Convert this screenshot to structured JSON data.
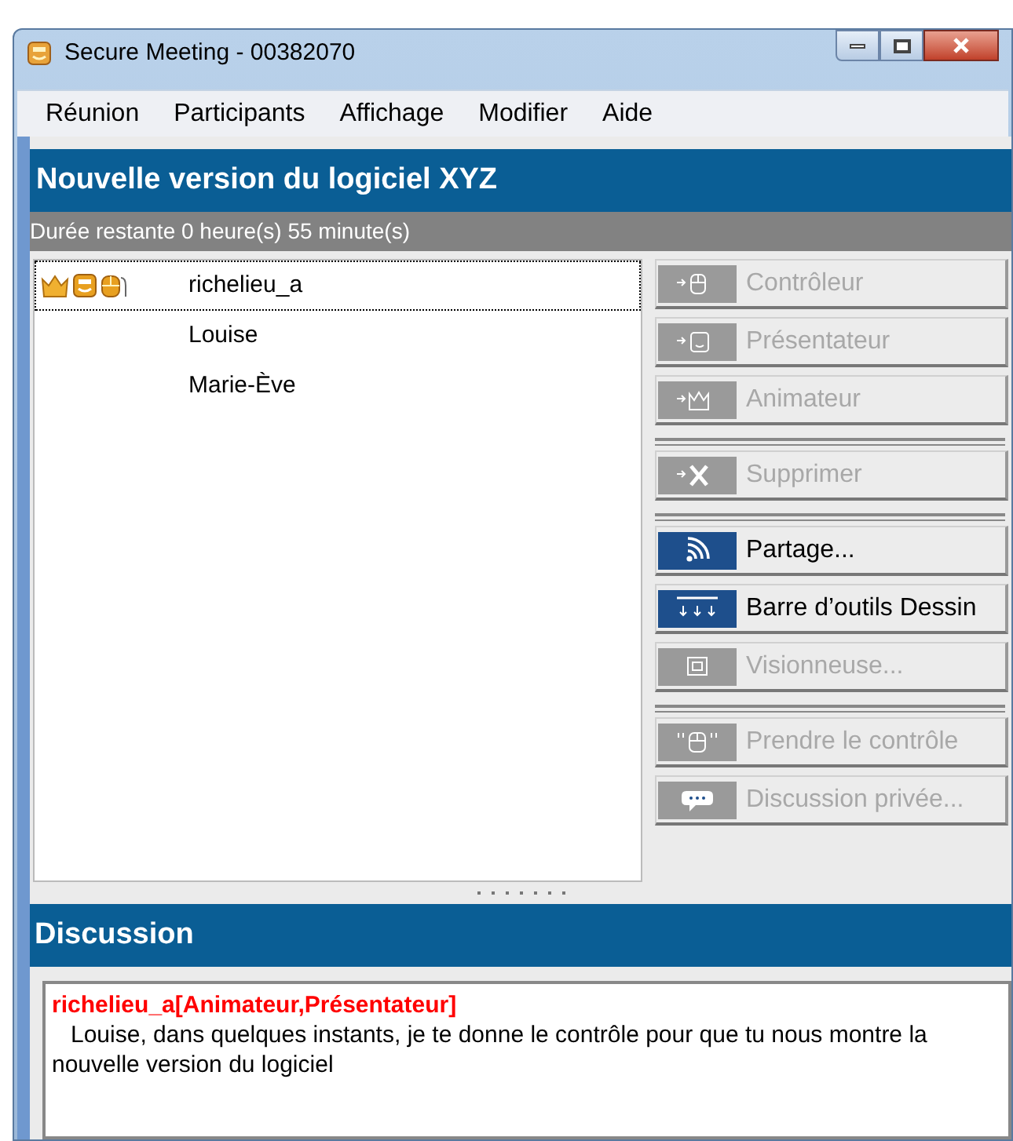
{
  "window": {
    "title": "Secure Meeting - 00382070"
  },
  "menu": [
    "Réunion",
    "Participants",
    "Affichage",
    "Modifier",
    "Aide"
  ],
  "meeting": {
    "title": "Nouvelle version du logiciel XYZ",
    "remaining": "Durée restante 0 heure(s) 55 minute(s)"
  },
  "participants": [
    {
      "name": "richelieu_a",
      "selected": true,
      "animateur": true,
      "presentateur": true,
      "controleur": true
    },
    {
      "name": "Louise",
      "selected": false,
      "animateur": false,
      "presentateur": false,
      "controleur": false
    },
    {
      "name": "Marie-Ève",
      "selected": false,
      "animateur": false,
      "presentateur": false,
      "controleur": false
    }
  ],
  "button_groups": [
    [
      {
        "label": "Contrôleur",
        "disabled": true
      },
      {
        "label": "Présentateur",
        "disabled": true
      },
      {
        "label": "Animateur",
        "disabled": true
      }
    ],
    [
      {
        "label": "Supprimer",
        "disabled": true
      }
    ],
    [
      {
        "label": "Partage...",
        "disabled": false
      },
      {
        "label": "Barre d’outils Dessin",
        "disabled": false
      },
      {
        "label": "Visionneuse...",
        "disabled": true
      }
    ],
    [
      {
        "label": "Prendre le contrôle",
        "disabled": true
      },
      {
        "label": "Discussion privée...",
        "disabled": true
      }
    ]
  ],
  "discussion": {
    "title": "Discussion",
    "messages": [
      {
        "author": "richelieu_a[Animateur,Présentateur]",
        "text": "Louise, dans quelques instants, je te donne le contrôle pour que tu nous montre la nouvelle version du logiciel"
      }
    ]
  }
}
